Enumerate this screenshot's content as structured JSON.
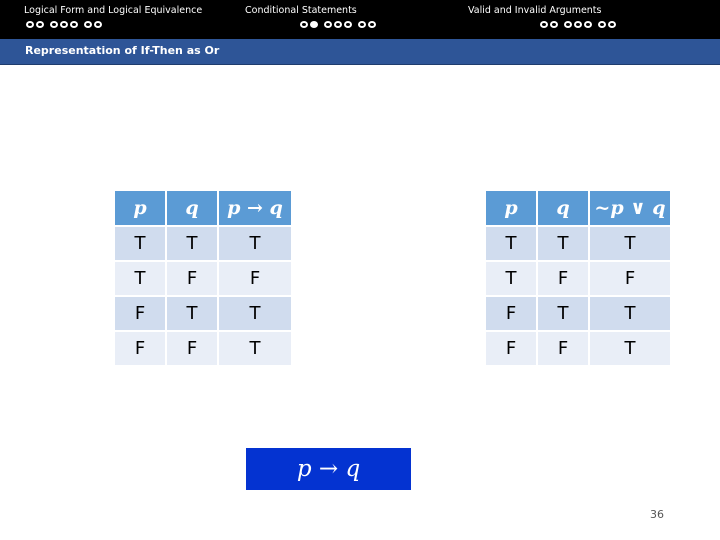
{
  "header": {
    "sections": [
      {
        "title": "Logical Form and Logical Equivalence",
        "dots": [
          false,
          false,
          false,
          false,
          false,
          false,
          false
        ],
        "groups": [
          2,
          3,
          2
        ]
      },
      {
        "title": "Conditional Statements",
        "dots": [
          false,
          true,
          false,
          false,
          false,
          false,
          false
        ],
        "groups": [
          2,
          3,
          2
        ]
      },
      {
        "title": "Valid and Invalid Arguments",
        "dots": [
          false,
          false,
          false,
          false,
          false,
          false,
          false
        ],
        "groups": [
          2,
          3,
          2
        ]
      }
    ]
  },
  "frame": {
    "title": "Representation of If-Then as Or"
  },
  "table_left": {
    "headers": [
      "p",
      "q",
      "p → q"
    ],
    "rows": [
      [
        "T",
        "T",
        "T"
      ],
      [
        "T",
        "F",
        "F"
      ],
      [
        "F",
        "T",
        "T"
      ],
      [
        "F",
        "F",
        "T"
      ]
    ]
  },
  "table_right": {
    "headers": [
      "p",
      "q",
      "~p ∨ q"
    ],
    "rows": [
      [
        "T",
        "T",
        "T"
      ],
      [
        "T",
        "F",
        "F"
      ],
      [
        "F",
        "T",
        "T"
      ],
      [
        "F",
        "F",
        "T"
      ]
    ]
  },
  "formula": "p → q",
  "page_number": "36",
  "colors": {
    "header_bg": "#000000",
    "frame_bar": "#2e5597",
    "table_header": "#5b9bd5",
    "row_odd": "#d0dcee",
    "row_even": "#e9eef7",
    "formula_box": "#0433d1"
  }
}
